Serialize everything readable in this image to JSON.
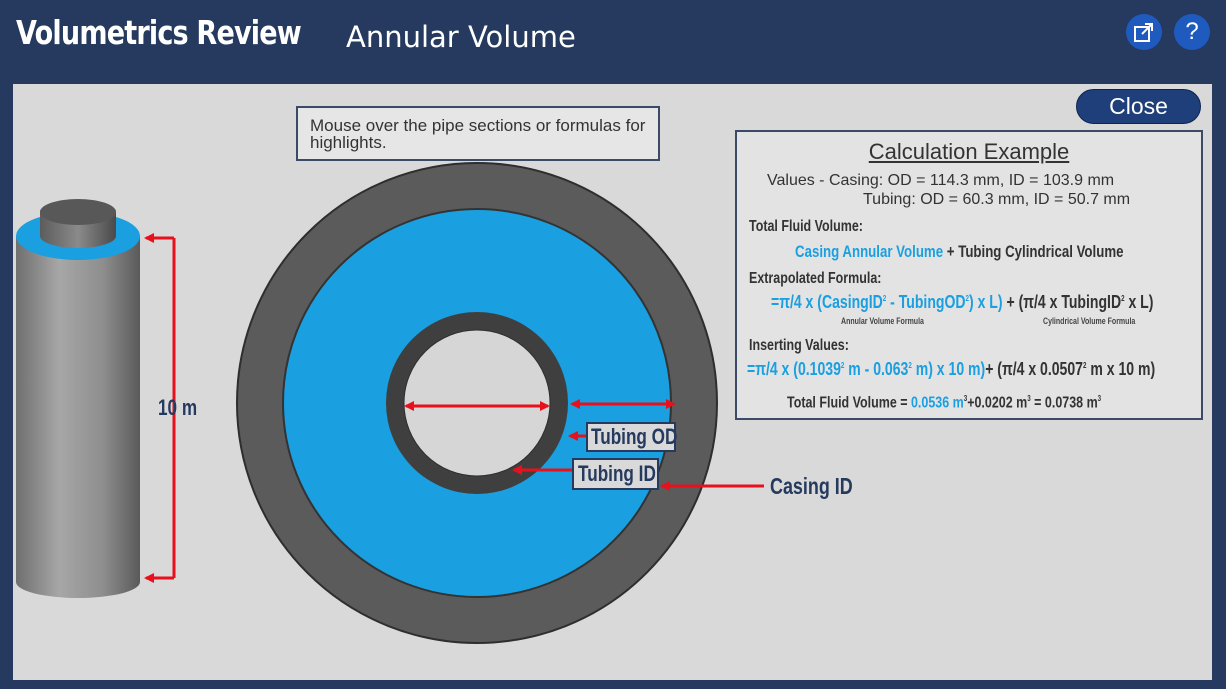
{
  "header": {
    "app_title": "Volumetrics Review",
    "page_title": "Annular Volume",
    "popout_icon": "popout-icon",
    "help_label": "?"
  },
  "close_label": "Close",
  "hint": "Mouse over the pipe sections or formulas for highlights.",
  "pipe": {
    "length_label": "10 m"
  },
  "labels": {
    "tubing_od": "Tubing OD",
    "tubing_id": "Tubing ID",
    "casing_id": "Casing ID"
  },
  "calc": {
    "title": "Calculation Example",
    "values_casing": "Values - Casing: OD = 114.3 mm, ID = 103.9 mm",
    "values_tubing": "Tubing: OD = 60.3 mm, ID = 50.7 mm",
    "total_fluid_label": "Total Fluid Volume:",
    "casing_annular": "Casing Annular Volume",
    "plus_tubing_cyl": "+ Tubing Cylindrical Volume",
    "extrap_label": "Extrapolated Formula:",
    "formula_annular_pre": "=π/4 x (CasingID",
    "formula_annular_mid": " - TubingOD",
    "formula_annular_post": ") x L)",
    "formula_cyl_pre": "+ (π/4 x TubingID",
    "formula_cyl_post": " x L)",
    "annular_caption": "Annular Volume Formula",
    "cyl_caption": "Cylindrical Volume Formula",
    "insert_label": "Inserting Values:",
    "insert_annular_pre": "=π/4 x (0.1039",
    "insert_annular_mid": " m - 0.063",
    "insert_annular_post": " m)  x 10 m)",
    "insert_cyl_pre": "+ (π/4 x 0.0507",
    "insert_cyl_post": " m x 10 m)",
    "sq": "2",
    "cube": "3",
    "total_pre": "Total Fluid Volume = ",
    "total_annular": "0.0536 m",
    "total_mid": "+0.0202 m",
    "total_post": "  = 0.0738 m"
  },
  "colors": {
    "header": "#253a5e",
    "accent_blue": "#1a9fe0",
    "arrow_red": "#e8101a",
    "panel": "#d9d9d9"
  }
}
